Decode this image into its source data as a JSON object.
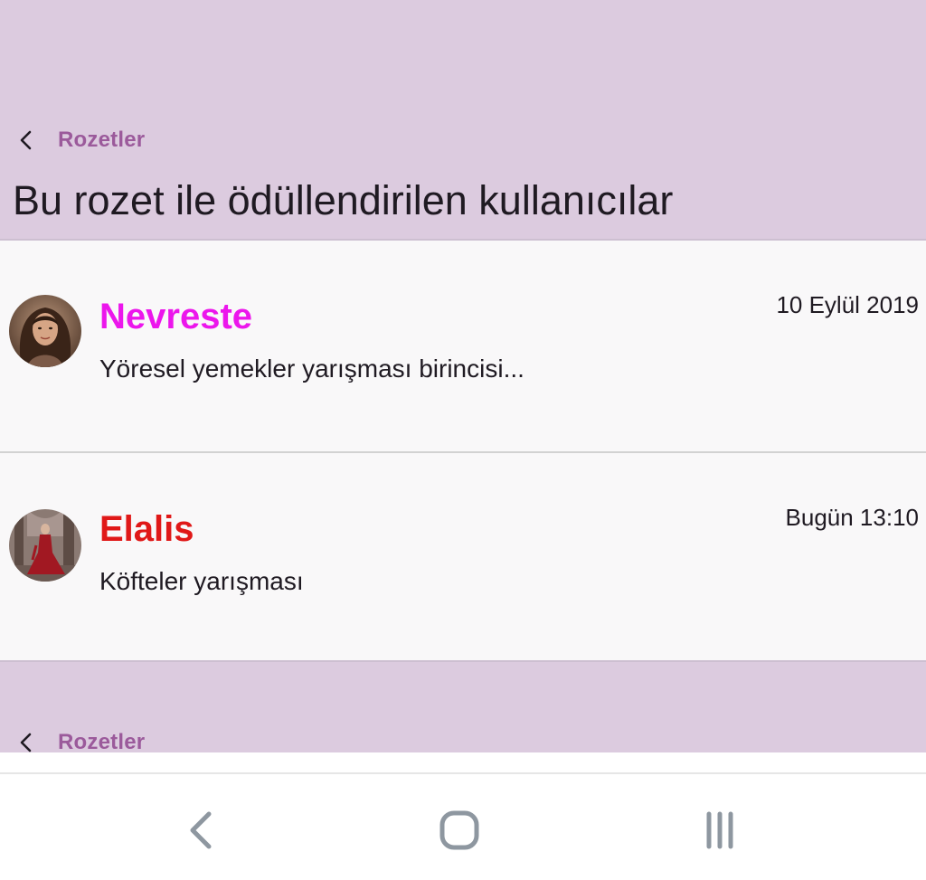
{
  "header": {
    "breadcrumb_label": "Rozetler",
    "title": "Bu rozet ile ödüllendirilen kullanıcılar"
  },
  "users": [
    {
      "name": "Nevreste",
      "name_color": "#ec16ec",
      "summary": "Yöresel yemekler yarışması birincisi...",
      "date": "10 Eylül 2019"
    },
    {
      "name": "Elalis",
      "name_color": "#e01818",
      "summary": "Köfteler yarışması",
      "date": "Bugün 13:10"
    }
  ],
  "footer": {
    "breadcrumb_label": "Rozetler"
  },
  "navbar": {
    "back_icon": "back-icon",
    "home_icon": "home-icon",
    "recents_icon": "recents-icon"
  },
  "colors": {
    "header_bg": "#dccbdf",
    "accent": "#9b5a9b",
    "list_bg": "#f9f8f9"
  }
}
